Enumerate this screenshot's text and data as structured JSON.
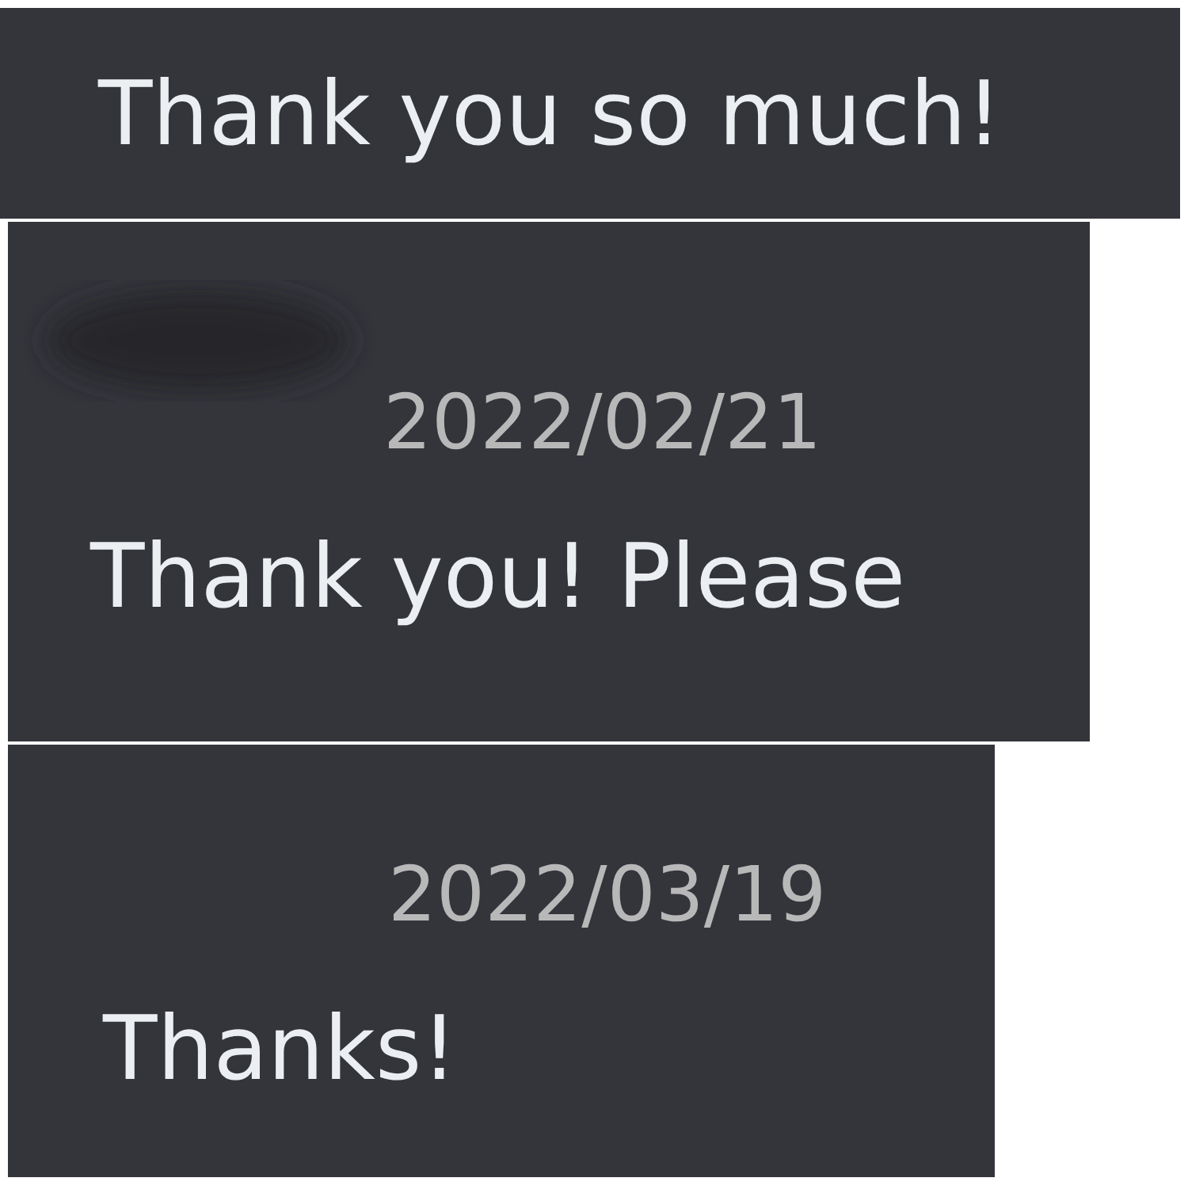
{
  "messages": [
    {
      "text": "Thank you so much!"
    },
    {
      "name_hidden": true,
      "date": "2022/02/21",
      "text": "Thank you! Please"
    },
    {
      "date": "2022/03/19",
      "text": "Thanks!"
    }
  ]
}
